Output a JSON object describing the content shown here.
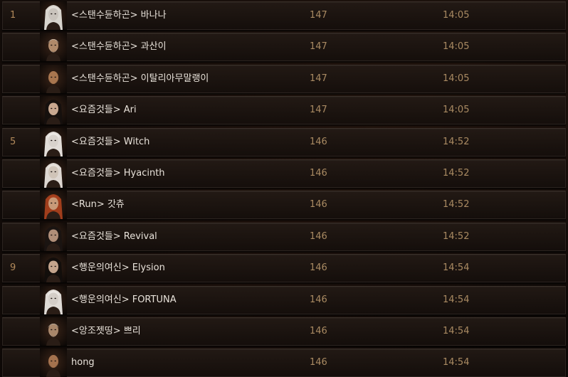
{
  "leaderboard": {
    "rows": [
      {
        "rank": "1",
        "name": "<스탠수듄하곤> 바나나",
        "level": "147",
        "time": "14:05",
        "portrait": "witch-doctor-white-hair-portrait-icon",
        "skin": "#c9c3bc",
        "hair": "#e2ded8"
      },
      {
        "rank": "",
        "name": "<스탠수듄하곤> 과산이",
        "level": "147",
        "time": "14:05",
        "portrait": "barbarian-old-man-portrait-icon",
        "skin": "#b08a6a",
        "hair": "#d8d2c8"
      },
      {
        "rank": "",
        "name": "<스탠수듄하곤> 이탈리아무말랭이",
        "level": "147",
        "time": "14:05",
        "portrait": "monk-bald-man-portrait-icon",
        "skin": "#a8764f",
        "hair": "#3a2a1e"
      },
      {
        "rank": "",
        "name": "<요즘것들> Ari",
        "level": "147",
        "time": "14:05",
        "portrait": "demon-hunter-dark-hair-portrait-icon",
        "skin": "#c8a890",
        "hair": "#15100e"
      },
      {
        "rank": "5",
        "name": "<요즘것들> Witch",
        "level": "146",
        "time": "14:52",
        "portrait": "necromancer-white-hair-portrait-icon",
        "skin": "#d8d2cc",
        "hair": "#ece8e4"
      },
      {
        "rank": "",
        "name": "<요즘것들> Hyacinth",
        "level": "146",
        "time": "14:52",
        "portrait": "crusader-white-hair-portrait-icon",
        "skin": "#d0c4b8",
        "hair": "#e8e2dc"
      },
      {
        "rank": "",
        "name": "<Run> 갓츄",
        "level": "146",
        "time": "14:52",
        "portrait": "wizard-red-hair-portrait-icon",
        "skin": "#c89a78",
        "hair": "#a8401e"
      },
      {
        "rank": "",
        "name": "<요즘것들> Revival",
        "level": "146",
        "time": "14:52",
        "portrait": "demon-hunter-dark-hair-portrait-icon",
        "skin": "#b08e78",
        "hair": "#1a1412"
      },
      {
        "rank": "9",
        "name": "<행운의여신> Elysion",
        "level": "146",
        "time": "14:54",
        "portrait": "demon-hunter-dark-hair-portrait-icon",
        "skin": "#c4a48c",
        "hair": "#120e0c"
      },
      {
        "rank": "",
        "name": "<행운의여신> FORTUNA",
        "level": "146",
        "time": "14:54",
        "portrait": "necromancer-white-hair-portrait-icon",
        "skin": "#d4cec8",
        "hair": "#eae6e2"
      },
      {
        "rank": "",
        "name": "<앙조젯띵> 쁘리",
        "level": "146",
        "time": "14:54",
        "portrait": "barbarian-old-man-portrait-icon",
        "skin": "#a8866a",
        "hair": "#ccc6bc"
      },
      {
        "rank": "",
        "name": "hong",
        "level": "146",
        "time": "14:54",
        "portrait": "monk-bald-man-portrait-icon",
        "skin": "#a4724e",
        "hair": "#3a2a1e"
      }
    ]
  },
  "colors": {
    "rank": "#b28a5b",
    "name": "#e8e2da",
    "stat": "#a98a62",
    "row_border": "#2c2420"
  }
}
